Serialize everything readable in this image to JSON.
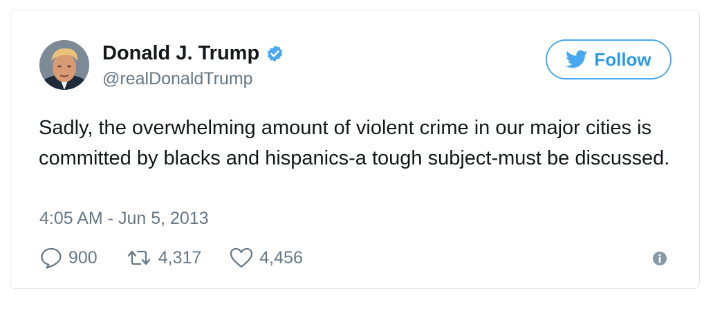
{
  "tweet": {
    "author": {
      "name": "Donald J. Trump",
      "handle": "@realDonaldTrump",
      "verified": true
    },
    "follow_label": "Follow",
    "text": "Sadly, the overwhelming amount of violent crime in our major cities is committed by blacks and hispanics-a tough subject-must be discussed.",
    "timestamp": "4:05 AM - Jun 5, 2013",
    "actions": {
      "replies": "900",
      "retweets": "4,317",
      "likes": "4,456"
    }
  },
  "colors": {
    "accent": "#1da1f2",
    "text": "#14171a",
    "muted": "#657786",
    "border": "#e1e8ed"
  },
  "icons": {
    "verified": "verified-badge-icon",
    "follow": "twitter-bird-icon",
    "reply": "reply-bubble-icon",
    "retweet": "retweet-icon",
    "like": "heart-icon",
    "info": "info-icon"
  }
}
